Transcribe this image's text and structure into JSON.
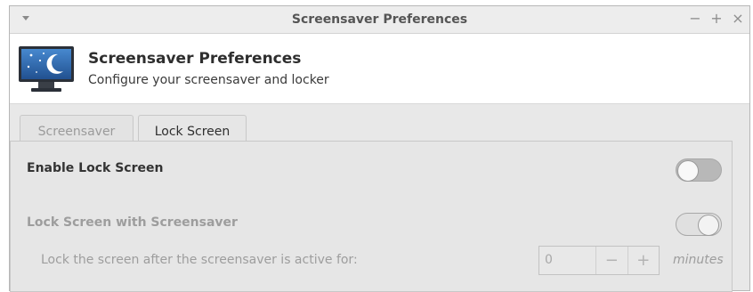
{
  "window": {
    "title": "Screensaver Preferences",
    "controls": {
      "minimize": "−",
      "maximize": "+",
      "close": "×"
    }
  },
  "header": {
    "icon": "monitor-moon-icon",
    "title": "Screensaver Preferences",
    "subtitle": "Configure your screensaver and locker"
  },
  "tabs": [
    {
      "label": "Screensaver",
      "active": false
    },
    {
      "label": "Lock Screen",
      "active": true
    }
  ],
  "lock_screen": {
    "enable_label": "Enable Lock Screen",
    "enable_on": false,
    "with_screensaver_label": "Lock Screen with Screensaver",
    "with_screensaver_on": false,
    "lock_after_label": "Lock the screen after the screensaver is active for:",
    "lock_after_value": "0",
    "decrement": "−",
    "increment": "+",
    "units": "minutes"
  },
  "colors": {
    "window_bg": "#e8e8e8",
    "header_bg": "#ffffff",
    "disabled_text": "#9d9d9d"
  }
}
